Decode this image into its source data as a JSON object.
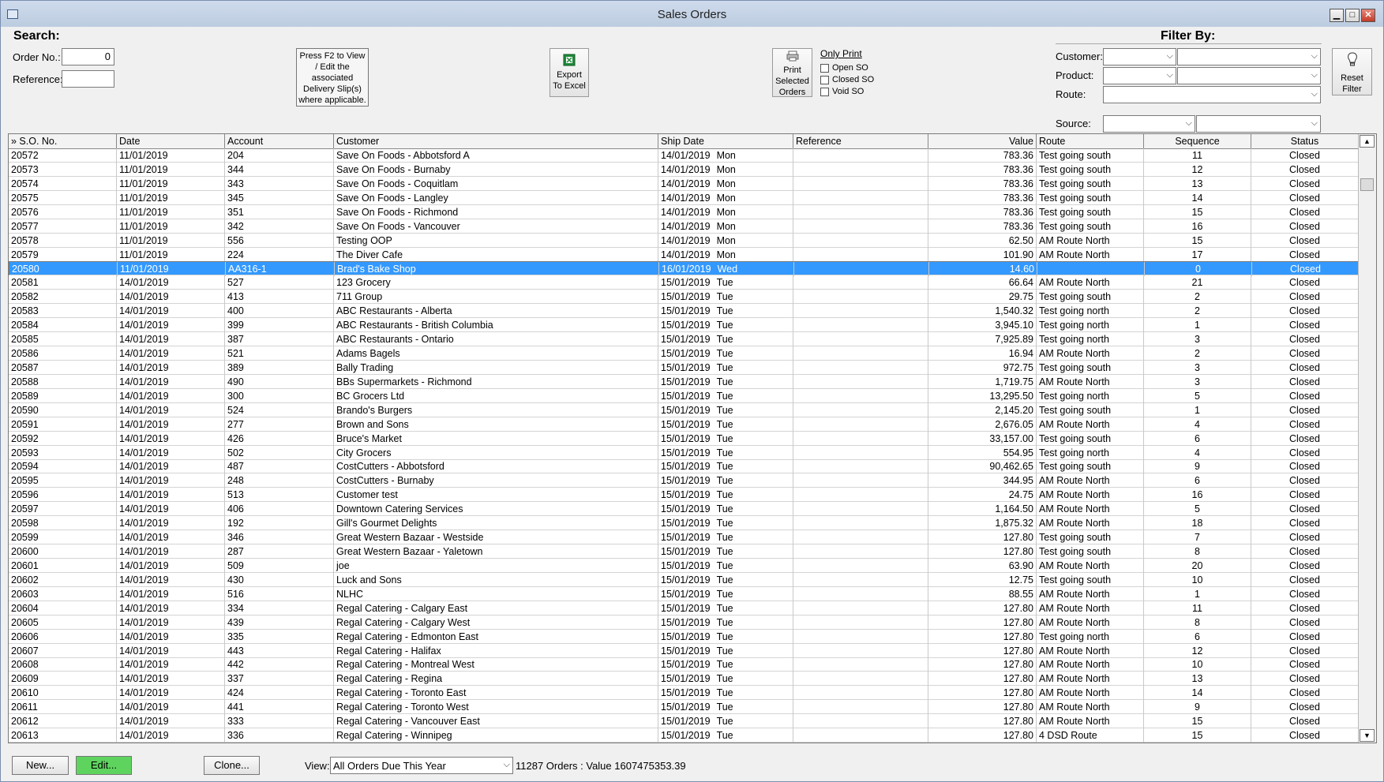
{
  "window": {
    "title": "Sales Orders",
    "min": "▁",
    "max": "□",
    "close": "✕"
  },
  "search": {
    "heading": "Search:",
    "order_no_label": "Order No.:",
    "order_no_value": "0",
    "reference_label": "Reference:",
    "reference_value": ""
  },
  "note": [
    "Press F2 to View",
    "/ Edit the",
    "associated",
    "Delivery Slip(s)",
    "where applicable."
  ],
  "export": {
    "line1": "Export",
    "line2": "To Excel"
  },
  "print": {
    "line1": "Print",
    "line2": "Selected",
    "line3": "Orders"
  },
  "only_print": {
    "title": "Only Print",
    "open": "Open SO",
    "closed": "Closed SO",
    "void": "Void SO"
  },
  "filter": {
    "heading": "Filter By:",
    "customer": "Customer:",
    "product": "Product:",
    "route": "Route:",
    "source": "Source:",
    "reset1": "Reset",
    "reset2": "Filter"
  },
  "grid": {
    "columns": [
      "» S.O. No.",
      "Date",
      "Account",
      "Customer",
      "Ship Date",
      "Reference",
      "Value",
      "Route",
      "Sequence",
      "Status"
    ],
    "selected_index": 8,
    "rows": [
      [
        "20572",
        "11/01/2019",
        "204",
        "Save On Foods - Abbotsford A",
        "14/01/2019",
        "Mon",
        "",
        "783.36",
        "Test going south",
        "11",
        "Closed"
      ],
      [
        "20573",
        "11/01/2019",
        "344",
        "Save On Foods - Burnaby",
        "14/01/2019",
        "Mon",
        "",
        "783.36",
        "Test going south",
        "12",
        "Closed"
      ],
      [
        "20574",
        "11/01/2019",
        "343",
        "Save On Foods - Coquitlam",
        "14/01/2019",
        "Mon",
        "",
        "783.36",
        "Test going south",
        "13",
        "Closed"
      ],
      [
        "20575",
        "11/01/2019",
        "345",
        "Save On Foods - Langley",
        "14/01/2019",
        "Mon",
        "",
        "783.36",
        "Test going south",
        "14",
        "Closed"
      ],
      [
        "20576",
        "11/01/2019",
        "351",
        "Save On Foods - Richmond",
        "14/01/2019",
        "Mon",
        "",
        "783.36",
        "Test going south",
        "15",
        "Closed"
      ],
      [
        "20577",
        "11/01/2019",
        "342",
        "Save On Foods - Vancouver",
        "14/01/2019",
        "Mon",
        "",
        "783.36",
        "Test going south",
        "16",
        "Closed"
      ],
      [
        "20578",
        "11/01/2019",
        "556",
        "Testing OOP",
        "14/01/2019",
        "Mon",
        "",
        "62.50",
        "AM Route North",
        "15",
        "Closed"
      ],
      [
        "20579",
        "11/01/2019",
        "224",
        "The Diver Cafe",
        "14/01/2019",
        "Mon",
        "",
        "101.90",
        "AM Route North",
        "17",
        "Closed"
      ],
      [
        "20580",
        "11/01/2019",
        "AA316-1",
        "Brad's Bake Shop",
        "16/01/2019",
        "Wed",
        "",
        "14.60",
        "",
        "0",
        "Closed"
      ],
      [
        "20581",
        "14/01/2019",
        "527",
        "123 Grocery",
        "15/01/2019",
        "Tue",
        "",
        "66.64",
        "AM Route North",
        "21",
        "Closed"
      ],
      [
        "20582",
        "14/01/2019",
        "413",
        "711 Group",
        "15/01/2019",
        "Tue",
        "",
        "29.75",
        "Test going south",
        "2",
        "Closed"
      ],
      [
        "20583",
        "14/01/2019",
        "400",
        "ABC Restaurants - Alberta",
        "15/01/2019",
        "Tue",
        "",
        "1,540.32",
        "Test going north",
        "2",
        "Closed"
      ],
      [
        "20584",
        "14/01/2019",
        "399",
        "ABC Restaurants - British Columbia",
        "15/01/2019",
        "Tue",
        "",
        "3,945.10",
        "Test going north",
        "1",
        "Closed"
      ],
      [
        "20585",
        "14/01/2019",
        "387",
        "ABC Restaurants - Ontario",
        "15/01/2019",
        "Tue",
        "",
        "7,925.89",
        "Test going north",
        "3",
        "Closed"
      ],
      [
        "20586",
        "14/01/2019",
        "521",
        "Adams Bagels",
        "15/01/2019",
        "Tue",
        "",
        "16.94",
        "AM Route North",
        "2",
        "Closed"
      ],
      [
        "20587",
        "14/01/2019",
        "389",
        "Bally Trading",
        "15/01/2019",
        "Tue",
        "",
        "972.75",
        "Test going south",
        "3",
        "Closed"
      ],
      [
        "20588",
        "14/01/2019",
        "490",
        "BBs Supermarkets - Richmond",
        "15/01/2019",
        "Tue",
        "",
        "1,719.75",
        "AM Route North",
        "3",
        "Closed"
      ],
      [
        "20589",
        "14/01/2019",
        "300",
        "BC Grocers Ltd",
        "15/01/2019",
        "Tue",
        "",
        "13,295.50",
        "Test going north",
        "5",
        "Closed"
      ],
      [
        "20590",
        "14/01/2019",
        "524",
        "Brando's Burgers",
        "15/01/2019",
        "Tue",
        "",
        "2,145.20",
        "Test going south",
        "1",
        "Closed"
      ],
      [
        "20591",
        "14/01/2019",
        "277",
        "Brown and Sons",
        "15/01/2019",
        "Tue",
        "",
        "2,676.05",
        "AM Route North",
        "4",
        "Closed"
      ],
      [
        "20592",
        "14/01/2019",
        "426",
        "Bruce's Market",
        "15/01/2019",
        "Tue",
        "",
        "33,157.00",
        "Test going south",
        "6",
        "Closed"
      ],
      [
        "20593",
        "14/01/2019",
        "502",
        "City Grocers",
        "15/01/2019",
        "Tue",
        "",
        "554.95",
        "Test going north",
        "4",
        "Closed"
      ],
      [
        "20594",
        "14/01/2019",
        "487",
        "CostCutters - Abbotsford",
        "15/01/2019",
        "Tue",
        "",
        "90,462.65",
        "Test going south",
        "9",
        "Closed"
      ],
      [
        "20595",
        "14/01/2019",
        "248",
        "CostCutters - Burnaby",
        "15/01/2019",
        "Tue",
        "",
        "344.95",
        "AM Route North",
        "6",
        "Closed"
      ],
      [
        "20596",
        "14/01/2019",
        "513",
        "Customer test",
        "15/01/2019",
        "Tue",
        "",
        "24.75",
        "AM Route North",
        "16",
        "Closed"
      ],
      [
        "20597",
        "14/01/2019",
        "406",
        "Downtown Catering Services",
        "15/01/2019",
        "Tue",
        "",
        "1,164.50",
        "AM Route North",
        "5",
        "Closed"
      ],
      [
        "20598",
        "14/01/2019",
        "192",
        "Gill's Gourmet Delights",
        "15/01/2019",
        "Tue",
        "",
        "1,875.32",
        "AM Route North",
        "18",
        "Closed"
      ],
      [
        "20599",
        "14/01/2019",
        "346",
        "Great Western Bazaar - Westside",
        "15/01/2019",
        "Tue",
        "",
        "127.80",
        "Test going south",
        "7",
        "Closed"
      ],
      [
        "20600",
        "14/01/2019",
        "287",
        "Great Western Bazaar - Yaletown",
        "15/01/2019",
        "Tue",
        "",
        "127.80",
        "Test going south",
        "8",
        "Closed"
      ],
      [
        "20601",
        "14/01/2019",
        "509",
        "joe",
        "15/01/2019",
        "Tue",
        "",
        "63.90",
        "AM Route North",
        "20",
        "Closed"
      ],
      [
        "20602",
        "14/01/2019",
        "430",
        "Luck and Sons",
        "15/01/2019",
        "Tue",
        "",
        "12.75",
        "Test going south",
        "10",
        "Closed"
      ],
      [
        "20603",
        "14/01/2019",
        "516",
        "NLHC",
        "15/01/2019",
        "Tue",
        "",
        "88.55",
        "AM Route North",
        "1",
        "Closed"
      ],
      [
        "20604",
        "14/01/2019",
        "334",
        "Regal Catering - Calgary East",
        "15/01/2019",
        "Tue",
        "",
        "127.80",
        "AM Route North",
        "11",
        "Closed"
      ],
      [
        "20605",
        "14/01/2019",
        "439",
        "Regal Catering - Calgary West",
        "15/01/2019",
        "Tue",
        "",
        "127.80",
        "AM Route North",
        "8",
        "Closed"
      ],
      [
        "20606",
        "14/01/2019",
        "335",
        "Regal Catering - Edmonton East",
        "15/01/2019",
        "Tue",
        "",
        "127.80",
        "Test going north",
        "6",
        "Closed"
      ],
      [
        "20607",
        "14/01/2019",
        "443",
        "Regal Catering - Halifax",
        "15/01/2019",
        "Tue",
        "",
        "127.80",
        "AM Route North",
        "12",
        "Closed"
      ],
      [
        "20608",
        "14/01/2019",
        "442",
        "Regal Catering - Montreal West",
        "15/01/2019",
        "Tue",
        "",
        "127.80",
        "AM Route North",
        "10",
        "Closed"
      ],
      [
        "20609",
        "14/01/2019",
        "337",
        "Regal Catering - Regina",
        "15/01/2019",
        "Tue",
        "",
        "127.80",
        "AM Route North",
        "13",
        "Closed"
      ],
      [
        "20610",
        "14/01/2019",
        "424",
        "Regal Catering - Toronto East",
        "15/01/2019",
        "Tue",
        "",
        "127.80",
        "AM Route North",
        "14",
        "Closed"
      ],
      [
        "20611",
        "14/01/2019",
        "441",
        "Regal Catering - Toronto West",
        "15/01/2019",
        "Tue",
        "",
        "127.80",
        "AM Route North",
        "9",
        "Closed"
      ],
      [
        "20612",
        "14/01/2019",
        "333",
        "Regal Catering - Vancouver East",
        "15/01/2019",
        "Tue",
        "",
        "127.80",
        "AM Route North",
        "15",
        "Closed"
      ],
      [
        "20613",
        "14/01/2019",
        "336",
        "Regal Catering - Winnipeg",
        "15/01/2019",
        "Tue",
        "",
        "127.80",
        "4 DSD Route",
        "15",
        "Closed"
      ]
    ]
  },
  "footer": {
    "new": "New...",
    "edit": "Edit...",
    "clone": "Clone...",
    "view_label": "View:",
    "view_value": "All Orders Due This Year",
    "summary": "11287 Orders : Value 1607475353.39"
  },
  "colors": {
    "selected_row": "#3399ff",
    "edit_button": "#5ed45e",
    "excel_icon": "#1f8a3a"
  }
}
